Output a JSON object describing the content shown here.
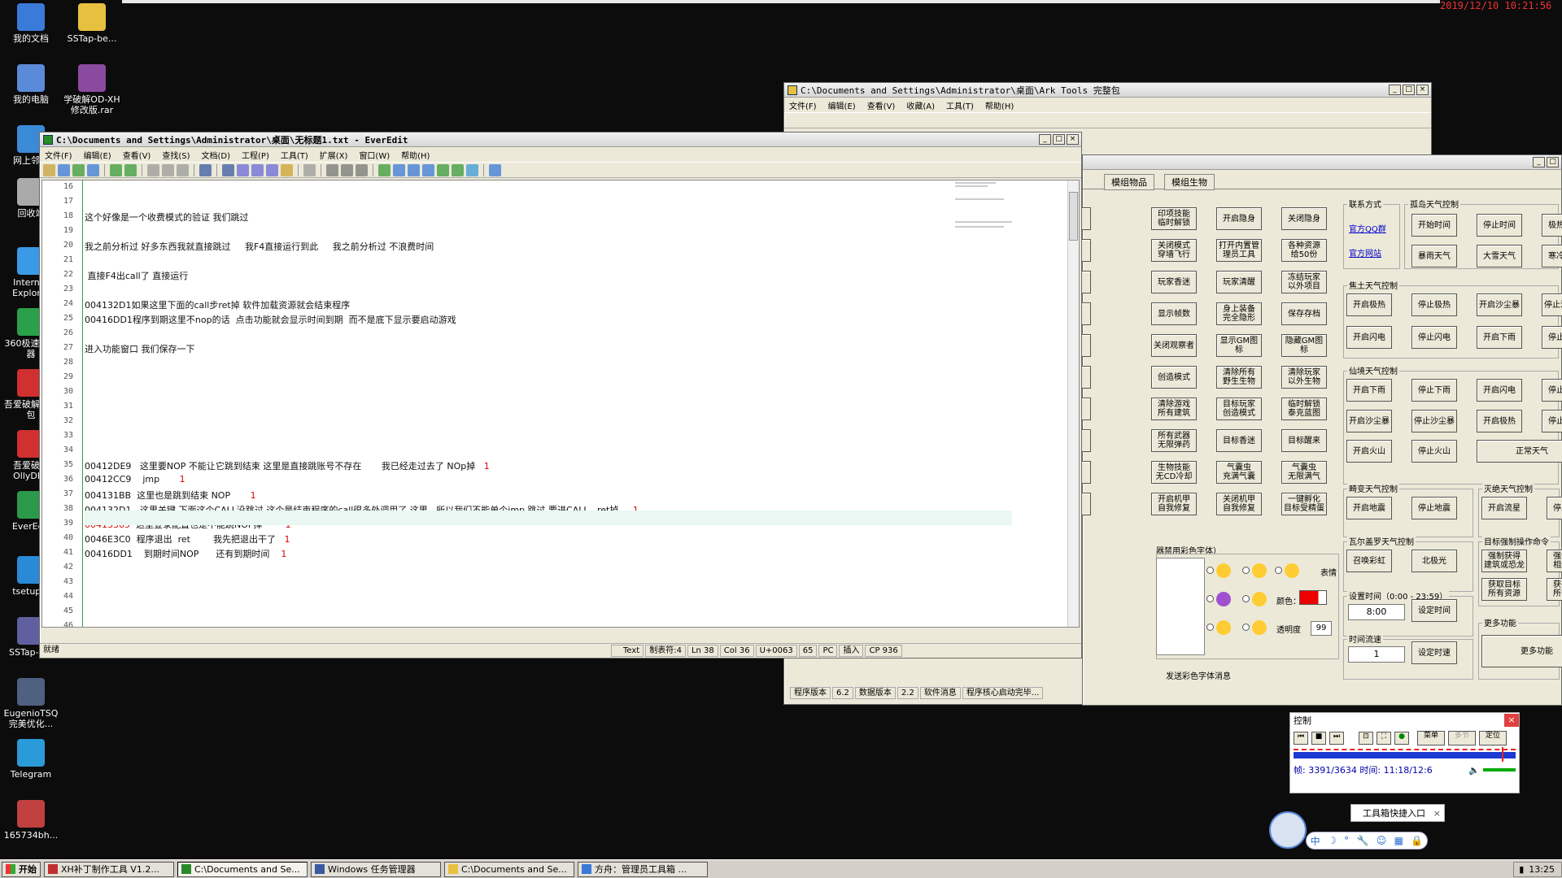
{
  "clock_top": "2019/12/10 10:21:56",
  "desktop_icons": [
    "我的文档",
    "SSTap-be...",
    "我的电脑",
    "学破解OD-XH修改版.rar",
    "网上邻居",
    "回收站",
    "Internet Explorer",
    "360极速浏览器",
    "吾爱破解工具包",
    "吾爱破解OllyDbg",
    "EverEdit",
    "tsetup...",
    "SSTap-b...",
    "EugenioTSQ完美优化...",
    "Telegram",
    "165734bh..."
  ],
  "ark": {
    "title": "C:\\Documents and Settings\\Administrator\\桌面\\Ark Tools 完整包",
    "menu": [
      "文件(F)",
      "编辑(E)",
      "查看(V)",
      "收藏(A)",
      "工具(T)",
      "帮助(H)"
    ]
  },
  "tool": {
    "tabs": [
      "模组物品",
      "模组生物"
    ],
    "col_a": [
      "印项技能|临时解锁",
      "开启隐身",
      "关闭隐身",
      "关闭模式|穿墙飞行",
      "打开内置管|理员工具",
      "各种资源|给50份",
      "玩家香迷",
      "玩家清醒",
      "冻结玩家|以外项目",
      "显示帧数",
      "身上装备|完全隐形",
      "保存存档",
      "关闭观察者",
      "显示GM图标",
      "隐藏GM图标",
      "创造模式",
      "清除所有|野生生物",
      "清除玩家|以外生物",
      "清除游戏|所有建筑",
      "目标玩家|创造模式",
      "临时解锁|泰克蓝图",
      "所有武器|无限弹药",
      "目标香迷",
      "目标醒来",
      "生物技能|无CD冷却",
      "气囊虫|充满气囊",
      "气囊虫|无限满气",
      "开启机甲|自我修复",
      "关闭机甲|自我修复",
      "一键孵化|目标受精蛋"
    ],
    "contact_label": "联系方式",
    "qq_link": "官方QQ群",
    "site_link": "官方网站",
    "island_label": "孤岛天气控制",
    "island": [
      "开始时间",
      "停止时间",
      "极热天气",
      "暴雨天气",
      "大雪天气",
      "寒冷天气"
    ],
    "scorched_label": "焦土天气控制",
    "scorched": [
      "开启极热",
      "停止极热",
      "开启沙尘暴",
      "停止沙尘暴",
      "开启闪电",
      "停止闪电",
      "开启下雨",
      "停止下雨"
    ],
    "fairy_label": "仙境天气控制",
    "fairy": [
      "开启下雨",
      "停止下雨",
      "开启闪电",
      "停止闪电",
      "开启沙尘暴",
      "停止沙尘暴",
      "开启极热",
      "停止极热",
      "开启火山",
      "停止火山",
      "正常天气"
    ],
    "hol_label": "畸变天气控制",
    "hol": [
      "开启地震",
      "停止地震"
    ],
    "ext_label": "灭绝天气控制",
    "ext": [
      "开启流星",
      "停止流星"
    ],
    "val_label": "瓦尔盖罗天气控制",
    "val": [
      "召唤彩虹",
      "北极光"
    ],
    "target_label": "目标强制操作命令",
    "target": [
      "强制获得|建筑或恐龙",
      "强制获得|相连建筑",
      "获取目标|所有资源",
      "获得目标|所有恐龙"
    ],
    "settime_label": "设置时间（0:00 - 23:59）",
    "settime_value": "8:00",
    "settime_btn": "设定时间",
    "flow_label": "时间流速",
    "flow_value": "1",
    "flow_btn": "设定时速",
    "more_label": "更多功能",
    "more_btn": "更多功能",
    "font_label": "器禁用彩色字体）",
    "emoji_label": "表情",
    "color_label": "颜色：",
    "alpha_label": "透明度",
    "alpha_value": "99",
    "send_label": "发送彩色字体消息",
    "status": [
      "程序版本",
      "6.2",
      "数据版本",
      "2.2",
      "软件消息",
      "程序核心启动完毕..."
    ]
  },
  "editor": {
    "title": "C:\\Documents and Settings\\Administrator\\桌面\\无标题1.txt - EverEdit",
    "menu": [
      "文件(F)",
      "编辑(E)",
      "查看(V)",
      "查找(S)",
      "文档(D)",
      "工程(P)",
      "工具(T)",
      "扩展(X)",
      "窗口(W)",
      "帮助(H)"
    ],
    "lines": [
      {
        "n": "16",
        "t": ""
      },
      {
        "n": "17",
        "t": ""
      },
      {
        "n": "18",
        "t": "这个好像是一个收费模式的验证 我们跳过"
      },
      {
        "n": "19",
        "t": ""
      },
      {
        "n": "20",
        "t": "我之前分析过 好多东西我就直接跳过     我F4直接运行到此     我之前分析过 不浪费时间"
      },
      {
        "n": "21",
        "t": ""
      },
      {
        "n": "22",
        "t": " 直接F4出call了 直接运行"
      },
      {
        "n": "23",
        "t": ""
      },
      {
        "n": "24",
        "t": "004132D1如果这里下面的call步ret掉 软件加载资源就会结束程序"
      },
      {
        "n": "25",
        "t": "00416DD1程序到期这里不nop的话  点击功能就会显示时间到期  而不是底下显示要启动游戏"
      },
      {
        "n": "26",
        "t": ""
      },
      {
        "n": "27",
        "t": "进入功能窗口 我们保存一下"
      },
      {
        "n": "28",
        "t": ""
      },
      {
        "n": "29",
        "t": ""
      },
      {
        "n": "30",
        "t": ""
      },
      {
        "n": "31",
        "t": ""
      },
      {
        "n": "32",
        "t": ""
      },
      {
        "n": "33",
        "t": ""
      },
      {
        "n": "34",
        "t": ""
      },
      {
        "n": "35",
        "t": "00412DE9   这里要NOP 不能让它跳到结束 这里是直接跳账号不存在       我已经走过去了 NOp掉   ",
        "r": "1"
      },
      {
        "n": "36",
        "t": "00412CC9    jmp       ",
        "r": "1"
      },
      {
        "n": "37",
        "t": "004131BB  这里也是跳到结束 NOP       ",
        "r": "1"
      },
      {
        "n": "38",
        "t": "004132D1   这里关键 下面这个CALL没跳过 这个是结束程序的call很多处调用了 这里   所以我们不能单个jmp 跳过 要进CALL   ret掉     ",
        "r": "1"
      },
      {
        "n": "39",
        "t": "00413365  这里登录配置也是不能跳NOP掉        ",
        "r": "1",
        "red": true
      },
      {
        "n": "40",
        "t": "0046E3C0  程序退出  ret        我先把退出干了   ",
        "r": "1"
      },
      {
        "n": "41",
        "t": "00416DD1    到期时间NOP      还有到期时间    ",
        "r": "1"
      },
      {
        "n": "42",
        "t": ""
      },
      {
        "n": "43",
        "t": ""
      },
      {
        "n": "44",
        "t": ""
      },
      {
        "n": "45",
        "t": ""
      },
      {
        "n": "46",
        "t": ""
      }
    ],
    "status": [
      "就绪",
      "Text",
      "制表符:4",
      "Ln 38",
      "Col 36",
      "U+0063",
      "65",
      "PC",
      "插入",
      "CP 936"
    ]
  },
  "control": {
    "title": "控制",
    "btns": [
      "菜单",
      "多节",
      "定位"
    ],
    "frame_info": "帧: 3391/3634 时间: 11:18/12:6"
  },
  "tooltip": "工具箱快捷入口",
  "taskbar": {
    "start": "开始",
    "tasks": [
      "XH补丁制作工具 V1.2...",
      "C:\\Documents and Se...",
      "Windows 任务管理器",
      "C:\\Documents and Se...",
      "方舟：管理员工具箱 ..."
    ],
    "time": "13:25"
  }
}
